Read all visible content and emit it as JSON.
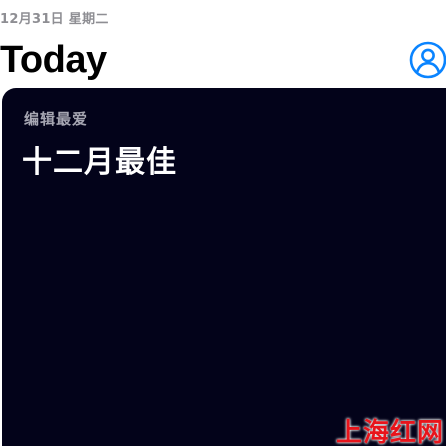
{
  "header": {
    "date": "12月31日 星期二",
    "title": "Today"
  },
  "icons": {
    "account": "account-icon"
  },
  "card": {
    "kicker": "编辑最爱",
    "headline": "十二月最佳"
  },
  "watermark": {
    "text": "上海红网"
  },
  "colors": {
    "accent": "#0a84ff",
    "card_background": "#03031a",
    "date_text": "#8e8e93",
    "watermark": "#e8141b"
  }
}
